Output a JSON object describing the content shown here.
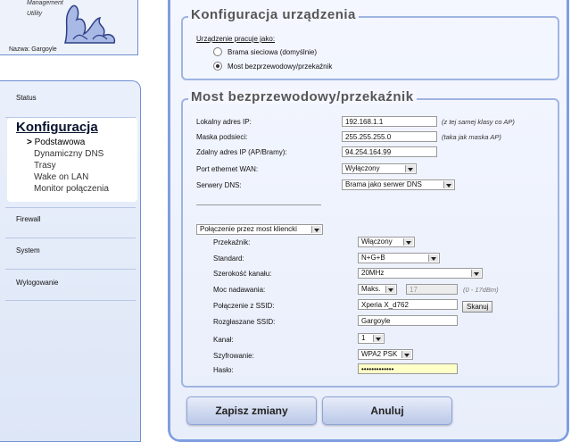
{
  "logo": {
    "line1": "Management",
    "line2": "Utility"
  },
  "device": {
    "name_label": "Nazwa: Gargoyle"
  },
  "nav": {
    "status": "Status",
    "konfiguracja": "Konfiguracja",
    "sub_items": [
      "Podstawowa",
      "Dynamiczny DNS",
      "Trasy",
      "Wake on LAN",
      "Monitor połączenia"
    ],
    "firewall": "Firewall",
    "system": "System",
    "logout": "Wylogowanie"
  },
  "device_config": {
    "title": "Konfiguracja urządzenia",
    "mode_label": "Urządzenie pracuje jako:",
    "options": [
      "Brama sieciowa (domyślnie)",
      "Most bezprzewodowy/przekaźnik"
    ],
    "selected_index": 1
  },
  "bridge": {
    "title": "Most bezprzewodowy/przekaźnik",
    "local_ip_label": "Lokalny adres IP:",
    "local_ip": "192.168.1.1",
    "local_ip_note": "(z tej samej klasy co AP)",
    "mask_label": "Maska podsieci:",
    "mask": "255.255.255.0",
    "mask_note": "(taka jak maska AP)",
    "remote_ip_label": "Zdalny adres IP (AP/Bramy):",
    "remote_ip": "94.254.164.99",
    "wan_port_label": "Port ethernet WAN:",
    "wan_port": "Wyłączony",
    "dns_label": "Serwery DNS:",
    "dns": "Brama jako serwer DNS",
    "connection_mode": "Połączenie przez most kliencki",
    "relay_label": "Przekaźnik:",
    "relay": "Włączony",
    "standard_label": "Standard:",
    "standard": "N+G+B",
    "width_label": "Szerokość kanału:",
    "width": "20MHz",
    "power_label": "Moc nadawania:",
    "power": "Maks.",
    "power_value": "17",
    "power_note": "(0 - 17dBm)",
    "ssid_label": "Połączenie z SSID:",
    "ssid": "Xperia X_d762",
    "scan_button": "Skanuj",
    "broadcast_label": "Rozgłaszane SSID:",
    "broadcast": "Gargoyle",
    "channel_label": "Kanał:",
    "channel": "1",
    "encryption_label": "Szyfrowanie:",
    "encryption": "WPA2 PSK",
    "password_label": "Hasło:",
    "password": "•••••••••••••"
  },
  "actions": {
    "save": "Zapisz zmiany",
    "cancel": "Anuluj"
  },
  "colors": {
    "accent": "#7f9ee0",
    "nav_text": "#1f2e55"
  }
}
